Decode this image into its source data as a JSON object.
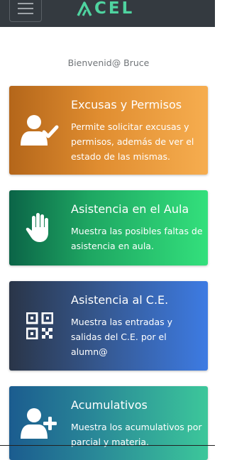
{
  "navbar": {
    "logo_text": "CEL",
    "menu_icon": "hamburger-icon",
    "logo_icon": "stylized-a-icon",
    "accent": "#4fd3a0",
    "background": "#343a40"
  },
  "welcome": "Bienvenid@ Bruce",
  "cards": [
    {
      "title": "Excusas y Permisos",
      "description": "Permite solicitar excusas y permisos, además de ver el estado de las mismas.",
      "icon": "user-check-icon",
      "colors": [
        "#b4661a",
        "#f6ad4f"
      ]
    },
    {
      "title": "Asistencia en el Aula",
      "description": "Muestra las posibles faltas de asistencia en aula.",
      "icon": "raised-hand-icon",
      "colors": [
        "#0b6447",
        "#33e07c"
      ]
    },
    {
      "title": "Asistencia al C.E.",
      "description": "Muestra las entradas y salidas del C.E. por el alumn@",
      "icon": "qr-code-icon",
      "colors": [
        "#2a3548",
        "#3d7be3"
      ]
    },
    {
      "title": "Acumulativos",
      "description": "Muestra los acumulativos por parcial y materia.",
      "icon": "user-plus-icon",
      "colors": [
        "#1b5c8f",
        "#3cc79a"
      ]
    }
  ]
}
